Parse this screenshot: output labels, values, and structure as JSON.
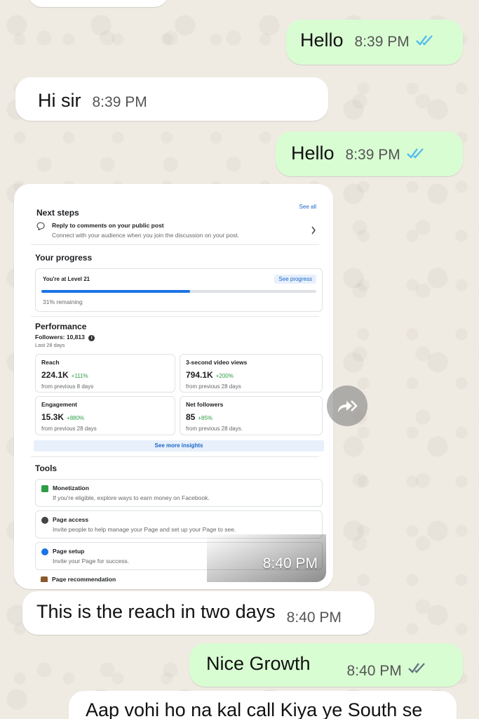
{
  "messages": [
    {
      "id": "m1",
      "dir": "out",
      "text": "Hello",
      "time": "8:39 PM",
      "ticks": "read"
    },
    {
      "id": "m2",
      "dir": "in",
      "text": "Hi sir",
      "time": "8:39 PM"
    },
    {
      "id": "m3",
      "dir": "out",
      "text": "Hello",
      "time": "8:39 PM",
      "ticks": "read"
    },
    {
      "id": "m5",
      "dir": "in",
      "text": "This is the reach in two days",
      "time": "8:40 PM"
    },
    {
      "id": "m6",
      "dir": "out",
      "text": "Nice Growth",
      "time": "8:40 PM",
      "ticks": "delivered"
    },
    {
      "id": "m7",
      "dir": "in",
      "text": "Aap vohi ho na kal call Kiya ye South se",
      "time": ""
    }
  ],
  "image_message": {
    "time": "8:40 PM",
    "screenshot": {
      "next_steps": {
        "title": "Next steps",
        "see_all": "See all",
        "item_title": "Reply to comments on your public post",
        "item_desc": "Connect with your audience when you join the discussion on your post."
      },
      "progress": {
        "title": "Your progress",
        "level": "You're at Level 21",
        "see_progress": "See progress",
        "fill_fraction": 0.54,
        "remaining": "31% remaining"
      },
      "performance": {
        "title": "Performance",
        "followers": "Followers: 10,813",
        "subtitle": "Last 28 days",
        "metrics": [
          {
            "label": "Reach",
            "value": "224.1K",
            "change": "+111%",
            "note": "from previous 8 days"
          },
          {
            "label": "3-second video views",
            "value": "794.1K",
            "change": "+200%",
            "note": "from previous 28 days"
          },
          {
            "label": "Engagement",
            "value": "15.3K",
            "change": "+880%",
            "note": "from previous 28 days"
          },
          {
            "label": "Net followers",
            "value": "85",
            "change": "+85%",
            "note": "from previous 28 days."
          }
        ],
        "see_more": "See more insights"
      },
      "tools": {
        "title": "Tools",
        "items": [
          {
            "title": "Monetization",
            "desc": "If you're eligible, explore ways to earn money on Facebook.",
            "icon": "monetization-icon"
          },
          {
            "title": "Page access",
            "desc": "Invite people to help manage your Page and set up your Page to see.",
            "icon": "page-access-icon"
          },
          {
            "title": "Page setup",
            "desc": "Invite your Page for success.",
            "icon": "page-setup-icon"
          },
          {
            "title": "Page recommendation",
            "desc": "",
            "icon": "recommendation-icon"
          }
        ]
      }
    }
  },
  "colors": {
    "incoming": "#ffffff",
    "outgoing": "#d9fdd3",
    "read_ticks": "#53bdeb",
    "delivered_ticks": "#667781",
    "wallpaper": "#efeae2"
  }
}
